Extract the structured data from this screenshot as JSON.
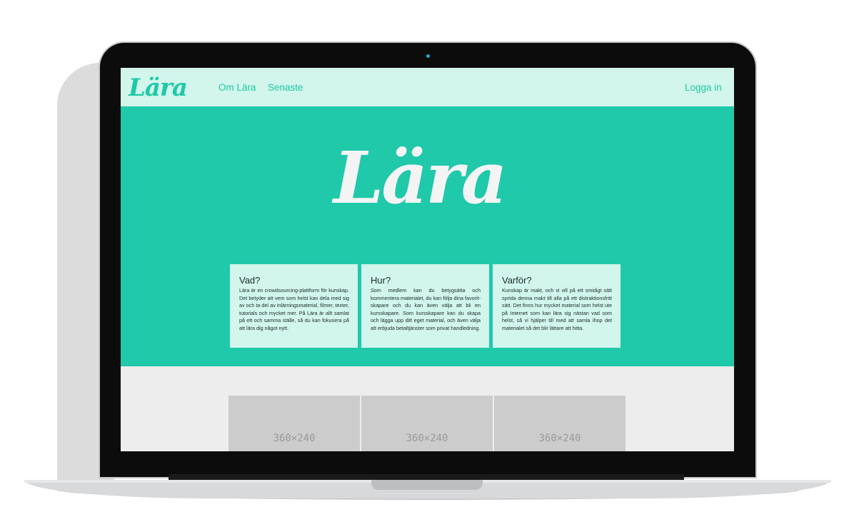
{
  "navbar": {
    "logo": "Lära",
    "links": [
      "Om Lära",
      "Senaste"
    ],
    "login": "Logga in"
  },
  "hero": {
    "logo": "Lära"
  },
  "cards": [
    {
      "title": "Vad?",
      "text": "Lära är en crowdsourcing-plattform för kunskap. Det betyder att vem som helst kan dela med sig av och ta del av inlärningsmaterial, filmer, texter, tutorials och mycket mer. På Lära är allt samlat på ett och samma ställe, så du kan fokusera på att lära dig något nytt."
    },
    {
      "title": "Hur?",
      "text": "Som medlem kan du betygsätta och kommentera materialet, du kan följa dina favorit-skapare och du kan även välja att bli en kursskapare. Som kursskapare kan du skapa och lägga upp ditt eget material, och även välja att erbjuda betaltjänster som privat handledning."
    },
    {
      "title": "Varför?",
      "text": "Kunskap är makt, och vi vill på ett smidigt sätt sprida denna makt till alla på ett distraktionsfritt sätt. Det finns hur mycket material som helst ute på Internet som kan lära sig nästan vad som helst, så vi hjälper till med att samla ihop det materialet så det blir lättare att hitta."
    }
  ],
  "thumbnails": [
    "360×240",
    "360×240",
    "360×240"
  ],
  "colors": {
    "accent": "#20c9aa",
    "nav_bg": "#d2f5ec",
    "card_bg": "#d2f5ec",
    "page_bg": "#ededed",
    "placeholder": "#cccccc"
  }
}
